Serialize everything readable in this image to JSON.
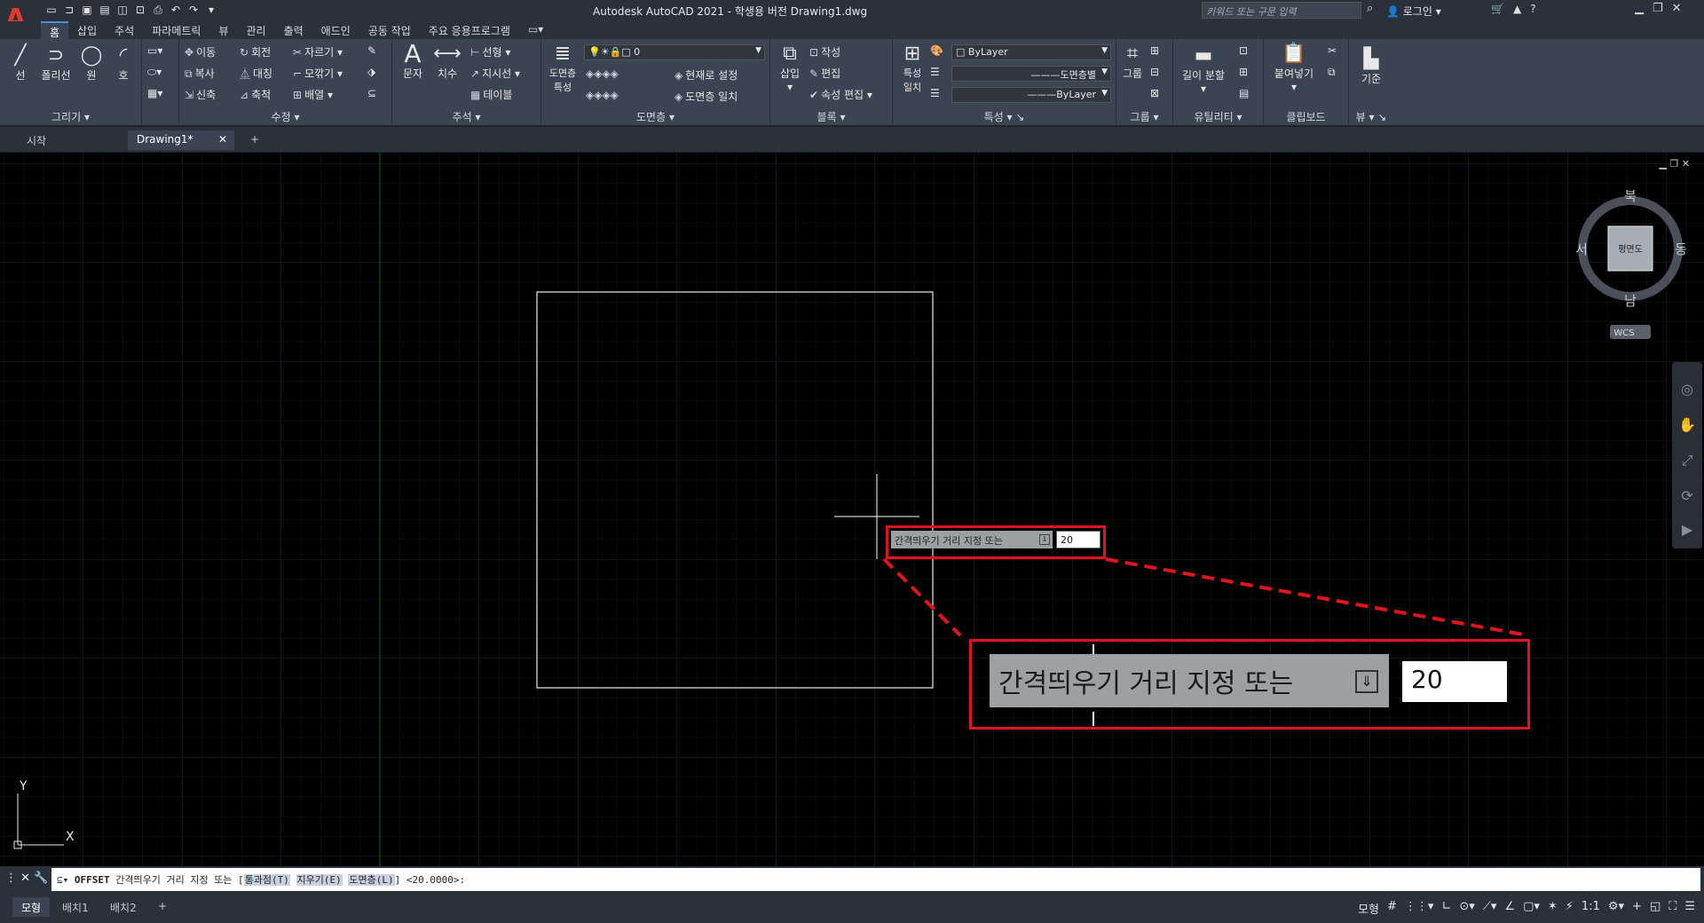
{
  "app": {
    "title": "Autodesk AutoCAD 2021 - 학생용 버전    Drawing1.dwg",
    "search_placeholder": "키워드 또는 구문 입력",
    "login": "로그인",
    "accent": "#e03a2f"
  },
  "menu": [
    "홈",
    "삽입",
    "주석",
    "파라메트릭",
    "뷰",
    "관리",
    "출력",
    "애드인",
    "공동 작업",
    "주요 응용프로그램"
  ],
  "ribbon": {
    "draw": {
      "label": "그리기",
      "line": "선",
      "polyline": "폴리선",
      "circle": "원",
      "arc": "호"
    },
    "modify": {
      "label": "수정",
      "move": "이동",
      "rotate": "회전",
      "trim": "자르기",
      "copy": "복사",
      "mirror": "대칭",
      "fillet": "모깎기",
      "stretch": "신축",
      "scale": "축척",
      "array": "배열"
    },
    "annotation": {
      "label": "주석",
      "text": "문자",
      "dimension": "치수",
      "linear": "선형",
      "leader": "지시선",
      "table": "테이블"
    },
    "layers": {
      "label": "도면층",
      "props": "도면층\n특성",
      "current": "0",
      "make_current": "현재로 설정",
      "match": "도면층 일치"
    },
    "block": {
      "label": "블록",
      "insert": "삽입",
      "create": "작성",
      "edit": "편집",
      "edit_attr": "속성 편집"
    },
    "properties": {
      "label": "특성",
      "match": "특성\n일치",
      "color": "ByLayer",
      "linetype": "도면층별",
      "lineweight": "ByLayer"
    },
    "groups": {
      "label": "그룹",
      "group": "그룹"
    },
    "utilities": {
      "label": "유틸리티",
      "measure": "길이 분할"
    },
    "clipboard": {
      "label": "클립보드",
      "paste": "붙여넣기"
    },
    "view": {
      "label": "뷰",
      "base": "기준"
    }
  },
  "doc_tabs": [
    "시작",
    "Drawing1*"
  ],
  "viewcube": {
    "north": "북",
    "south": "남",
    "east": "동",
    "west": "서",
    "face": "평면도",
    "wcs": "WCS"
  },
  "ucs": {
    "x": "X",
    "y": "Y"
  },
  "prompt": {
    "text": "간격띄우기 거리 지정 또는",
    "value": "20"
  },
  "cmd": {
    "name": "OFFSET",
    "text": "간격띄우기 거리 지정 또는",
    "opt1": "통과점(T)",
    "opt2": "지우기(E)",
    "opt3": "도면층(L)",
    "default": "<20.0000>:"
  },
  "layout_tabs": [
    "모형",
    "배치1",
    "배치2"
  ],
  "status": {
    "model": "모형",
    "scale": "1:1"
  }
}
